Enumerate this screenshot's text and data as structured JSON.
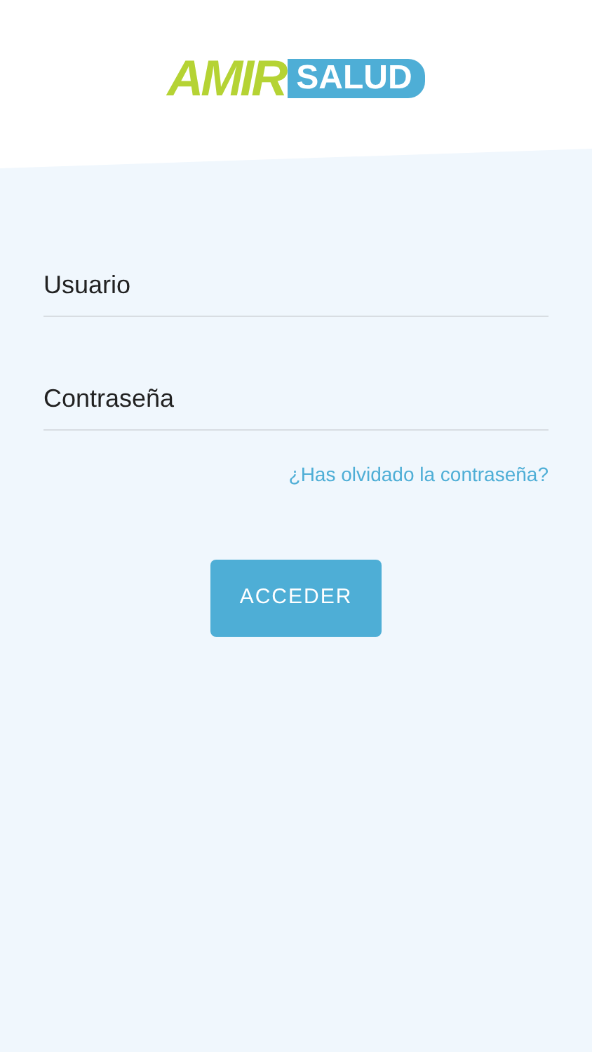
{
  "logo": {
    "brand": "AMIR",
    "tag": "SALUD"
  },
  "fields": [
    {
      "placeholder": "Usuario"
    },
    {
      "placeholder": "Contraseña"
    }
  ],
  "forgot_link": "¿Has olvidado la contraseña?",
  "submit_button": "ACCEDER"
}
